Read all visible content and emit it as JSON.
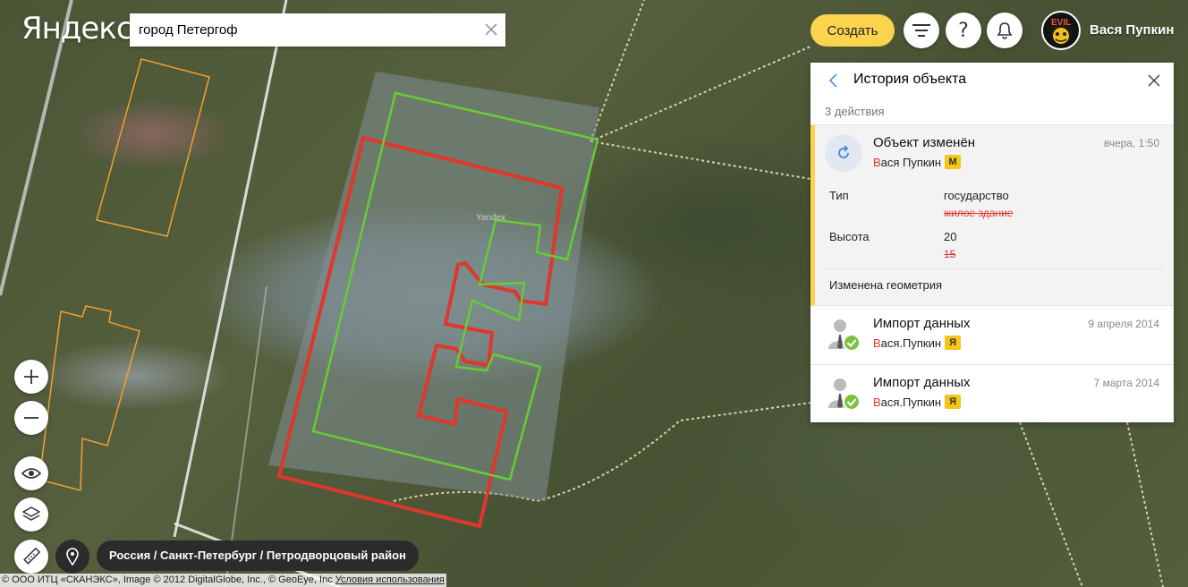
{
  "header": {
    "logo": "Яндекс",
    "search_value": "город Петергоф",
    "create_label": "Создать",
    "username": "Вася Пупкин"
  },
  "history": {
    "title": "История объекта",
    "count": "3 действия",
    "entries": [
      {
        "title": "Объект изменён",
        "user_first": "В",
        "user_rest": "ася Пупкин",
        "badge": "М",
        "date": "вчера, 1:50",
        "attributes": [
          {
            "key": "Тип",
            "new": "государство",
            "old": "жилое здание"
          },
          {
            "key": "Высота",
            "new": "20",
            "old": "15"
          }
        ],
        "note": "Изменена геометрия"
      },
      {
        "title": "Импорт данных",
        "user_first": "В",
        "user_rest": "ася.Пупкин",
        "badge": "Я",
        "date": "9 апреля 2014"
      },
      {
        "title": "Импорт данных",
        "user_first": "В",
        "user_rest": "ася.Пупкин",
        "badge": "Я",
        "date": "7 марта 2014"
      }
    ]
  },
  "map": {
    "breadcrumb": "Россия / Санкт-Петербург / Петродворцовый район",
    "watermark": "Yandex",
    "copyright": "© ООО ИТЦ «СКАНЭКС», Image © 2012 DigitalGlobe, Inc., © GeoEye, Inc",
    "terms_link": "Условия использования"
  },
  "colors": {
    "accent": "#fcd34d",
    "old_geometry": "#e0362b",
    "new_geometry": "#66cc33",
    "neighbor_outline": "#f0a030"
  }
}
